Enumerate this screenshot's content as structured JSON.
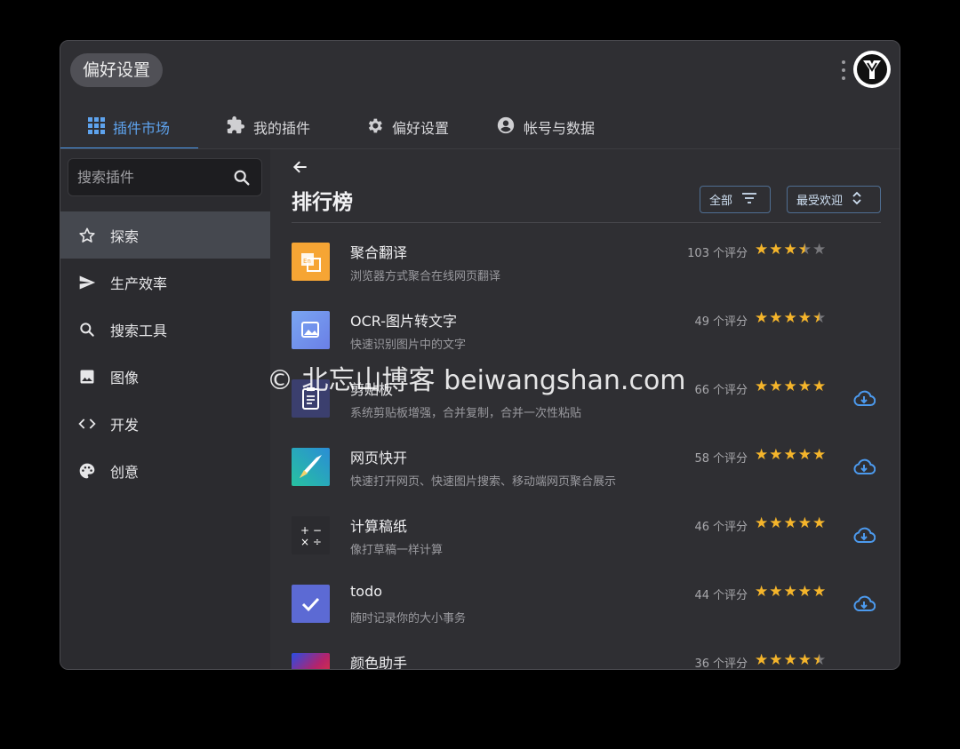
{
  "header": {
    "title": "偏好设置"
  },
  "tabs": [
    {
      "label": "插件市场",
      "icon": "grid-icon",
      "active": true
    },
    {
      "label": "我的插件",
      "icon": "puzzle-icon"
    },
    {
      "label": "偏好设置",
      "icon": "gear-icon"
    },
    {
      "label": "帐号与数据",
      "icon": "account-icon"
    }
  ],
  "sidebar": {
    "search_placeholder": "搜索插件",
    "items": [
      {
        "label": "探索",
        "icon": "star-outline-icon",
        "active": true
      },
      {
        "label": "生产效率",
        "icon": "paper-plane-icon"
      },
      {
        "label": "搜索工具",
        "icon": "search-icon"
      },
      {
        "label": "图像",
        "icon": "image-icon"
      },
      {
        "label": "开发",
        "icon": "code-icon"
      },
      {
        "label": "创意",
        "icon": "palette-icon"
      }
    ]
  },
  "main": {
    "title": "排行榜",
    "filter_label": "全部",
    "sort_label": "最受欢迎",
    "count_unit": "个评分",
    "plugins": [
      {
        "name": "聚合翻译",
        "desc": "浏览器方式聚合在线网页翻译",
        "count": "103",
        "rating": 3.5,
        "downloadable": false
      },
      {
        "name": "OCR-图片转文字",
        "desc": "快速识别图片中的文字",
        "count": "49",
        "rating": 4.5,
        "downloadable": false
      },
      {
        "name": "剪贴板",
        "desc": "系统剪贴板增强，合并复制，合并一次性粘贴",
        "count": "66",
        "rating": 5,
        "downloadable": true
      },
      {
        "name": "网页快开",
        "desc": "快速打开网页、快速图片搜索、移动端网页聚合展示",
        "count": "58",
        "rating": 5,
        "downloadable": true
      },
      {
        "name": "计算稿纸",
        "desc": "像打草稿一样计算",
        "count": "46",
        "rating": 5,
        "downloadable": true
      },
      {
        "name": "todo",
        "desc": "随时记录你的大小事务",
        "count": "44",
        "rating": 5,
        "downloadable": true
      },
      {
        "name": "颜色助手",
        "desc": "",
        "count": "36",
        "rating": 4.5,
        "downloadable": false
      }
    ]
  },
  "watermark": "© 北忘山博客 beiwangshan.com",
  "colors": {
    "accent": "#4c9aee",
    "star": "#f5b52b",
    "background": "#2f2f33"
  }
}
